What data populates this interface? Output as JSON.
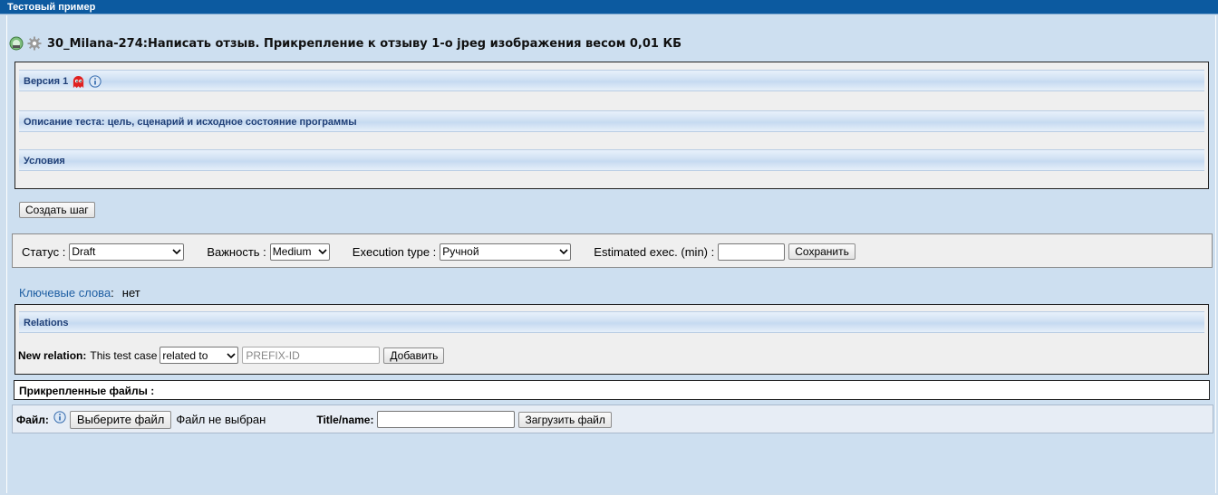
{
  "window": {
    "title": "Тестовый пример"
  },
  "testcase": {
    "title": "30_Milana-274:Написать отзыв. Прикрепление к отзыву 1-о jpeg изображения весом 0,01 КБ",
    "icons": [
      "execution-icon",
      "settings-gear-icon"
    ]
  },
  "sections": {
    "version": "Версия 1",
    "description": "Описание теста: цель, сценарий и исходное состояние программы",
    "conditions": "Условия"
  },
  "create_step_label": "Создать шаг",
  "attributes": {
    "status_label": "Статус :",
    "status_value": "Draft",
    "importance_label": "Важность :",
    "importance_value": "Medium",
    "exec_type_label": "Execution type :",
    "exec_type_value": "Ручной",
    "estimated_label": "Estimated exec. (min) :",
    "estimated_value": "",
    "save_label": "Сохранить"
  },
  "keywords": {
    "label": "Ключевые слова",
    "value": "нет"
  },
  "relations": {
    "title": "Relations",
    "new_relation_label": "New relation:",
    "this_test_case": "This test case",
    "relation_value": "related to",
    "prefix_placeholder": "PREFIX-ID",
    "add_label": "Добавить"
  },
  "attachments": {
    "title": "Прикрепленные файлы :",
    "file_label": "Файл:",
    "choose_file": "Выберите файл",
    "no_file": "Файл не выбран",
    "title_name_label": "Title/name:",
    "upload_label": "Загрузить файл"
  },
  "colors": {
    "titlebar": "#0c5aa0",
    "background": "#cfdfee",
    "section_text": "#1f3f77",
    "keywords_link": "#1f5fa3"
  }
}
